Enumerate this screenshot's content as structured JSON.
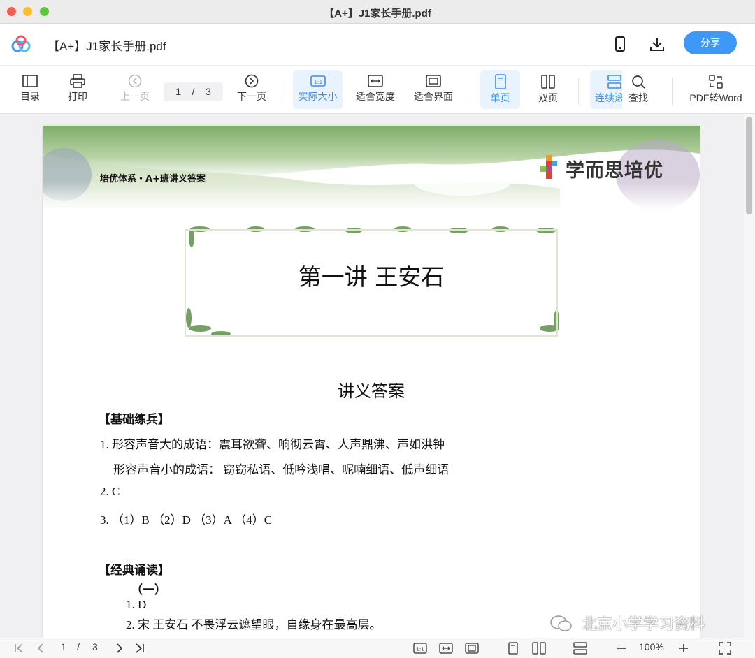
{
  "window": {
    "title": "【A+】J1家长手册.pdf"
  },
  "header": {
    "doc_title": "【A+】J1家长手册.pdf",
    "share_label": "分享"
  },
  "toolbar": {
    "toc": "目录",
    "print": "打印",
    "prev": "上一页",
    "page_current": "1",
    "page_sep": "/",
    "page_total": "3",
    "next": "下一页",
    "actual_size": "实际大小",
    "fit_width": "适合宽度",
    "fit_window": "适合界面",
    "single": "单页",
    "double": "双页",
    "continuous": "连续滚",
    "find": "查找",
    "pdf2word": "PDF转Word"
  },
  "pdf": {
    "series": "培优体系・A+班讲义答案",
    "brand": "学而思培优",
    "lecture_title": "第一讲  王安石",
    "answers_title": "讲义答案",
    "section1": "【基础练兵】",
    "q1a": "1.  形容声音大的成语：震耳欲聋、响彻云霄、人声鼎沸、声如洪钟",
    "q1b": "形容声音小的成语：  窃窃私语、低吟浅唱、呢喃细语、低声细语",
    "q2": "2.  C",
    "q3": "3.  （1）B  （2）D  （3）A  （4）C",
    "section2": "【经典诵读】",
    "sub1": "（一）",
    "s1": "1.  D",
    "s2": "2.  宋   王安石   不畏浮云遮望眼，自缘身在最高层。"
  },
  "statusbar": {
    "page_current": "1",
    "page_sep": "/",
    "page_total": "3",
    "zoom": "100%"
  },
  "watermark": "北京小学学习资料",
  "colors": {
    "accent": "#3d98f6",
    "active_bg": "#e9f3fe"
  }
}
